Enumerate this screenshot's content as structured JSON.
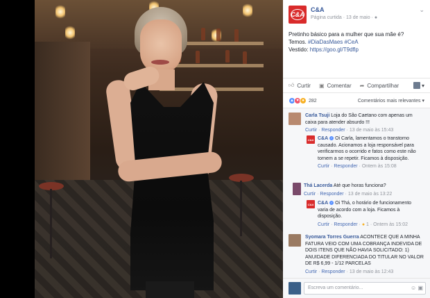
{
  "post": {
    "page_name": "C&A",
    "logo_text": "C&A",
    "meta": "Página curtida · 13 de maio ·",
    "body_line1": "Pretinho básico para a mulher que sua mãe é?",
    "body_line2_prefix": "Temos.",
    "hashtag1": "#DiaDasMaes",
    "hashtag2": "#CeA",
    "body_line3_prefix": "Vestido:",
    "link": "https://goo.gl/T9dflp"
  },
  "actions": {
    "like_label": "Curtir",
    "comment_label": "Comentar",
    "share_label": "Compartilhar"
  },
  "reactions": {
    "count": "282",
    "relevance_label": "Comentários mais relevantes"
  },
  "comments": [
    {
      "name": "Carla Tsuji",
      "text": "Loja do São Caetano com apenas um caixa para atender absurdo !!!",
      "like": "Curtir",
      "reply": "Responder",
      "time": "13 de maio às 15:43"
    },
    {
      "name": "C&A",
      "text": "Oi Carla, lamentamos o transtorno causado. Acionamos a loja responsável para verificarmos o ocorrido e fatos como este não tornem a se repetir. Ficamos à disposição.",
      "like": "Curtir",
      "reply": "Responder",
      "time": "Ontem às 15:08"
    },
    {
      "name": "Thá Lacerda",
      "text": "Até que horas funciona?",
      "like": "Curtir",
      "reply": "Responder",
      "time": "13 de maio às 13:22"
    },
    {
      "name": "C&A",
      "text": "Oi Thá, o horário de funcionamento varia de acordo com a loja. Ficamos à disposição.",
      "like": "Curtir",
      "reply": "Responder",
      "reaction_count": "1",
      "time": "Ontem às 15:02"
    },
    {
      "name": "Syomara Torres Guerra",
      "text": "ACONTECE QUE A MINHA FATURA VEIO COM UMA COBRANÇA INDEVIDA DE DOIS ITENS QUE NÃO HAVIA SOLICITADO: 1) ANUIDADE DIFERENCIADA DO TITULAR NO VALOR DE R$ 6,99 - 1/12 PARCELAS",
      "like": "Curtir",
      "reply": "Responder",
      "time": "13 de maio às 12:43"
    }
  ],
  "composer": {
    "placeholder": "Escreva um comentário..."
  },
  "colors": {
    "brand_red": "#d92b2b",
    "link_blue": "#365899",
    "like_blue": "#5890ff",
    "love_red": "#f25268"
  }
}
